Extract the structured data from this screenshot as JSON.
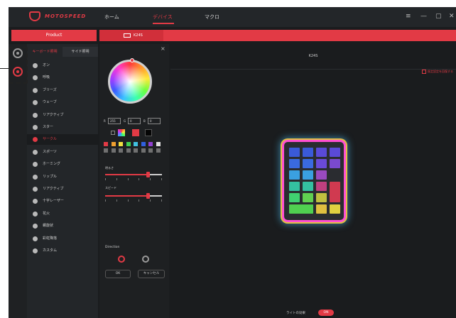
{
  "app": {
    "brand": "MOTOSPEED",
    "nav": [
      "ホーム",
      "デバイス",
      "マクロ"
    ],
    "window_controls": [
      "≡",
      "—",
      "▢",
      "✕"
    ]
  },
  "toolbar": {
    "product_label": "Product",
    "device_tab_label": "K24S"
  },
  "sidebar": {
    "tabs": [
      "キーボード照明",
      "サイド照明"
    ],
    "effects": [
      "オン",
      "呼吸",
      "ブリーズ",
      "ウェーブ",
      "リアクティブ",
      "スター",
      "サークル",
      "スポーツ",
      "ホーミング",
      "リップル",
      "リアクティブ",
      "十字レーザー",
      "花火",
      "螺旋状",
      "彩虹降落",
      "カスタム"
    ],
    "active_effect_index": 6
  },
  "color_panel": {
    "close": "×",
    "r": "255",
    "g": "0",
    "b": "0",
    "r_label": "R",
    "g_label": "G",
    "b_label": "B",
    "brightness_label": "明るさ",
    "brightness_level": 0.75,
    "speed_label": "スピード",
    "speed_level": 0.75,
    "direction_label": "Direction",
    "ok_label": "OK",
    "cancel_label": "キャンセル",
    "palette": [
      "#e23a45",
      "#f0a030",
      "#f0e040",
      "#40d050",
      "#40c0e0",
      "#3060e0",
      "#9040d0",
      "#e0e0e0",
      "#707070",
      "#707070",
      "#707070",
      "#707070",
      "#707070",
      "#707070",
      "#707070",
      "#707070"
    ]
  },
  "main": {
    "title": "K24S",
    "reset_label": "既定設定を回復する",
    "light_label": "ライトの効果",
    "light_toggle": "ON"
  }
}
